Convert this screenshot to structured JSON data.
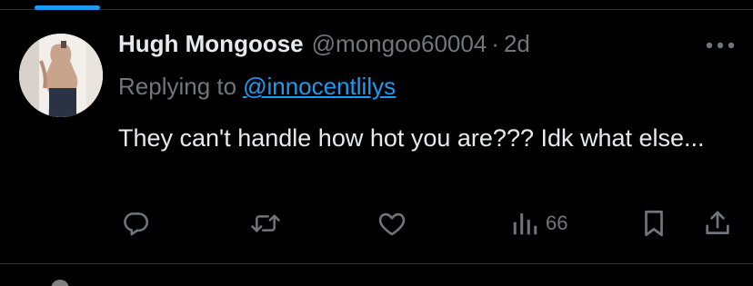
{
  "tweet": {
    "author": {
      "display_name": "Hugh Mongoose",
      "handle": "@mongoo60004"
    },
    "separator": "·",
    "time": "2d",
    "replying_to_prefix": "Replying to",
    "replying_to_handle": "@innocentlilys",
    "text": "They can't handle how hot you are??? Idk what else..."
  },
  "actions": {
    "reply_icon": "reply-bubble-icon",
    "retweet_icon": "retweet-icon",
    "like_icon": "heart-icon",
    "views_icon": "bar-chart-icon",
    "views_count": "66",
    "bookmark_icon": "bookmark-icon",
    "share_icon": "share-icon",
    "more_icon": "more-dots-icon"
  },
  "colors": {
    "background": "#000000",
    "text_primary": "#e7e9ea",
    "text_secondary": "#71767b",
    "accent": "#1d9bf0",
    "divider": "#2f3336"
  }
}
